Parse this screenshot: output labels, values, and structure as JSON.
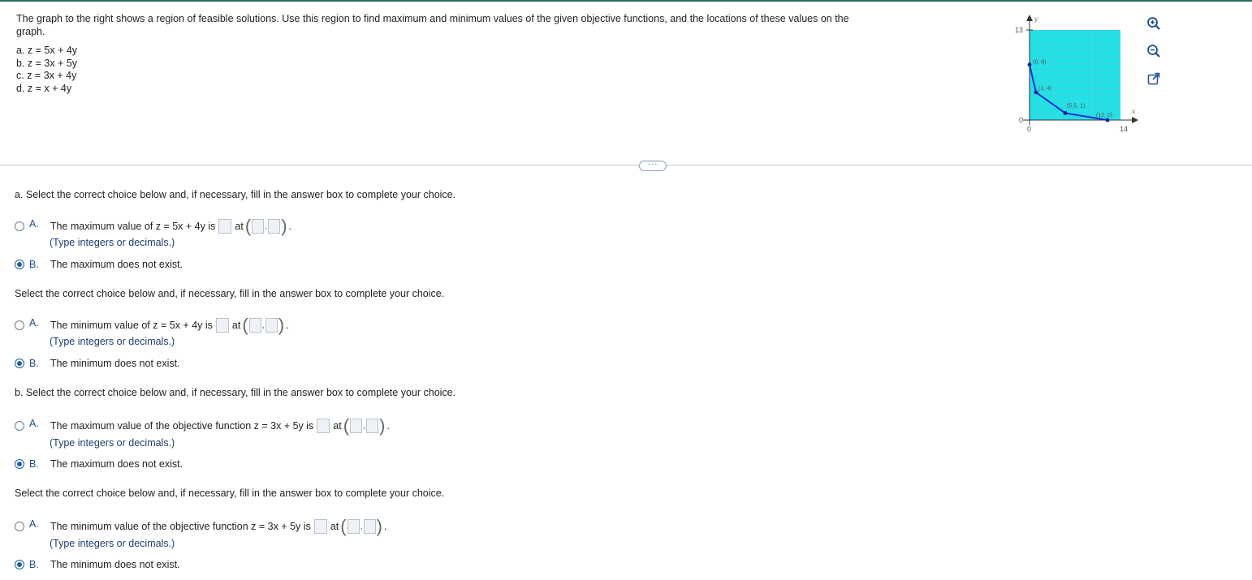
{
  "intro": "The graph to the right shows a region of feasible solutions. Use this region to find maximum and minimum values of the given objective functions, and the locations of these values on the graph.",
  "functions": [
    "a. z = 5x + 4y",
    "b. z = 3x + 5y",
    "c. z = 3x + 4y",
    "d. z = x + 4y"
  ],
  "graph": {
    "axis_labels": {
      "x": "x",
      "y": "y"
    },
    "ticks": {
      "y_top": "13",
      "y_zero": "0",
      "x_zero": "0",
      "x_right": "14"
    },
    "vertices": [
      {
        "label": "(0, 8)",
        "x": 0,
        "y": 8
      },
      {
        "label": "(1, 4)",
        "x": 1,
        "y": 4
      },
      {
        "label": "(5.5, 1)",
        "x": 5.5,
        "y": 1
      },
      {
        "label": "(12, 0)",
        "x": 12,
        "y": 0
      }
    ],
    "x_range": [
      0,
      14
    ],
    "y_range": [
      0,
      13
    ],
    "fill_color": "#20e3e8",
    "boundary_color": "#1a2fd6"
  },
  "toolbar": {
    "icons": [
      "zoom-in-icon",
      "zoom-out-icon",
      "popout-icon"
    ]
  },
  "more_button": "···",
  "part_a": {
    "max_prompt": "a. Select the correct choice below and, if necessary, fill in the answer box to complete your choice.",
    "max_A": {
      "letter": "A.",
      "text": "The maximum value of z = 5x + 4y is",
      "at": "at"
    },
    "max_hint": "(Type integers or decimals.)",
    "max_B": {
      "letter": "B.",
      "text": "The maximum does not exist."
    },
    "min_prompt": "Select the correct choice below and, if necessary, fill in the answer box to complete your choice.",
    "min_A": {
      "letter": "A.",
      "text": "The minimum value of z = 5x + 4y is",
      "at": "at"
    },
    "min_hint": "(Type integers or decimals.)",
    "min_B": {
      "letter": "B.",
      "text": "The minimum does not exist."
    }
  },
  "part_b": {
    "max_prompt": "b. Select the correct choice below and, if necessary, fill in the answer box to complete your choice.",
    "max_A": {
      "letter": "A.",
      "text": "The maximum value of the objective function z = 3x + 5y is",
      "at": "at"
    },
    "max_hint": "(Type integers or decimals.)",
    "max_B": {
      "letter": "B.",
      "text": "The maximum does not exist."
    },
    "min_prompt": "Select the correct choice below and, if necessary, fill in the answer box to complete your choice.",
    "min_A": {
      "letter": "A.",
      "text": "The minimum value of the objective function z = 3x + 5y is",
      "at": "at"
    },
    "min_hint": "(Type integers or decimals.)",
    "min_B": {
      "letter": "B.",
      "text": "The minimum does not exist."
    }
  },
  "selected": [
    "B",
    "B",
    "B",
    "B"
  ]
}
